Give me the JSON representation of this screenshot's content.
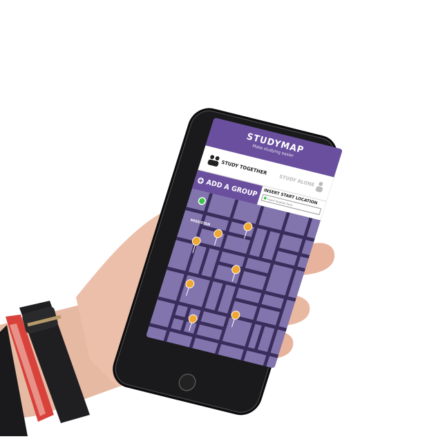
{
  "app": {
    "title": "STUDYMAP",
    "subtitle": "Make studying easier"
  },
  "modes": {
    "together_label": "STUDY TOGETHER",
    "alone_label": "STUDY ALONE"
  },
  "actions": {
    "add_group_label": "ADD A GROUP",
    "start_location_label": "INSERT START LOCATION",
    "start_location_placeholder": "Insert location here"
  },
  "map": {
    "street_label": "MISSISTAN",
    "pin_color": "#f0a832",
    "current_location_color": "#3cc24a",
    "road_color": "#3a2d5c",
    "block_color": "#8275ad"
  },
  "colors": {
    "brand": "#6a4f9e",
    "screen_bg": "#6b5b93"
  }
}
